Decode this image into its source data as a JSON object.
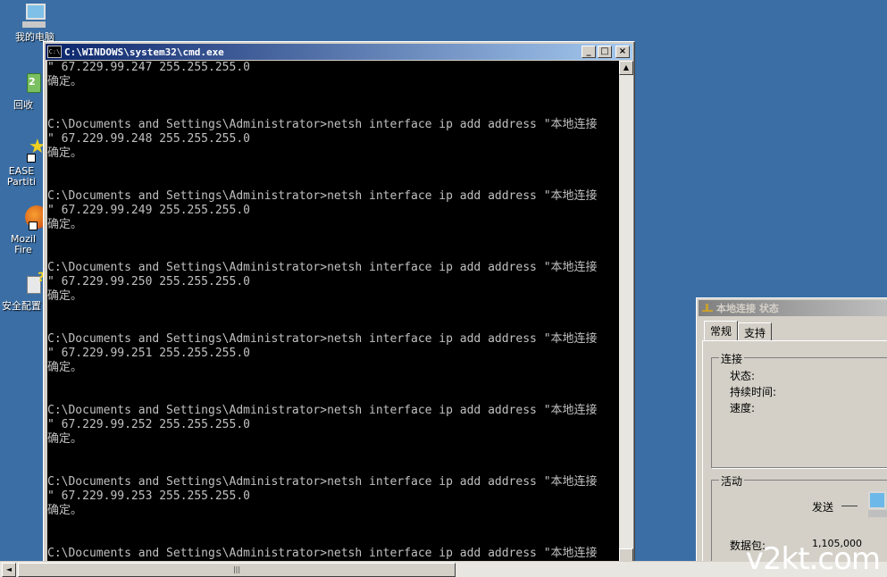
{
  "desktop": {
    "icons": [
      {
        "label": "我的电脑",
        "icon": "my-computer-icon"
      },
      {
        "label": "回收",
        "icon": "recycle-bin-icon"
      },
      {
        "label": "EASE",
        "label2": "Partiti",
        "icon": "partition-app-icon"
      },
      {
        "label": "Mozil",
        "label2": "Fire",
        "icon": "firefox-icon"
      },
      {
        "label": "安全配置",
        "icon": "security-config-icon"
      }
    ]
  },
  "cmd": {
    "title": "C:\\WINDOWS\\system32\\cmd.exe",
    "icon_text": "C:\\",
    "lines": [
      "\" 67.229.99.247 255.255.255.0",
      "确定。",
      "",
      "",
      "C:\\Documents and Settings\\Administrator>netsh interface ip add address \"本地连接",
      "\" 67.229.99.248 255.255.255.0",
      "确定。",
      "",
      "",
      "C:\\Documents and Settings\\Administrator>netsh interface ip add address \"本地连接",
      "\" 67.229.99.249 255.255.255.0",
      "确定。",
      "",
      "",
      "C:\\Documents and Settings\\Administrator>netsh interface ip add address \"本地连接",
      "\" 67.229.99.250 255.255.255.0",
      "确定。",
      "",
      "",
      "C:\\Documents and Settings\\Administrator>netsh interface ip add address \"本地连接",
      "\" 67.229.99.251 255.255.255.0",
      "确定。",
      "",
      "",
      "C:\\Documents and Settings\\Administrator>netsh interface ip add address \"本地连接",
      "\" 67.229.99.252 255.255.255.0",
      "确定。",
      "",
      "",
      "C:\\Documents and Settings\\Administrator>netsh interface ip add address \"本地连接",
      "\" 67.229.99.253 255.255.255.0",
      "确定。",
      "",
      "",
      "C:\\Documents and Settings\\Administrator>netsh interface ip add address \"本地连接"
    ]
  },
  "status_dialog": {
    "title": "本地连接 状态",
    "tabs": [
      "常规",
      "支持"
    ],
    "connection_group": "连接",
    "status_label": "状态:",
    "duration_label": "持续时间:",
    "speed_label": "速度:",
    "activity_group": "活动",
    "sent_label": "发送",
    "packets_label": "数据包:",
    "packets_sent": "1,105,000"
  },
  "watermark": "v2kt.com",
  "colors": {
    "desktop": "#3a6ea5",
    "title_active": "#0a246a",
    "console_bg": "#000000",
    "console_fg": "#c0c0c0"
  }
}
